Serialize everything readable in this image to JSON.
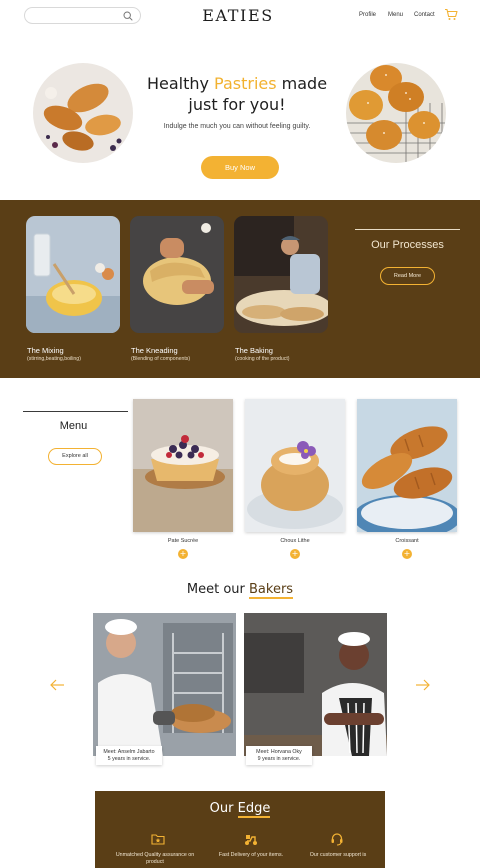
{
  "header": {
    "search_placeholder": "",
    "logo": "EATIES",
    "nav": [
      "Profile",
      "Menu",
      "Contact"
    ],
    "cart_icon": "cart-icon"
  },
  "hero": {
    "title_part1": "Healthy ",
    "title_accent": "Pastries",
    "title_part2": " made just for you!",
    "subtitle": "Indulge the much you can without feeling guilty.",
    "cta": "Buy Now",
    "accent_color": "#f3b233"
  },
  "processes": {
    "heading": "Our Processes",
    "read_more": "Read More",
    "band_color": "#5a3e16",
    "items": [
      {
        "title": "The Mixing",
        "sub": "(stirring,beating,boiling)"
      },
      {
        "title": "The Kneading",
        "sub": "(Blending of components)"
      },
      {
        "title": "The Baking",
        "sub": "(cooking of the product)"
      }
    ]
  },
  "menu": {
    "title": "Menu",
    "explore": "Explore all",
    "items": [
      {
        "name": "Pate Sucrée"
      },
      {
        "name": "Choux Lithe"
      },
      {
        "name": "Croissant"
      }
    ]
  },
  "bakers": {
    "title_part1": "Meet our ",
    "title_accent": "Bakers",
    "people": [
      {
        "line1": "Meet: Anselm Jabarto",
        "line2": "5 years in service."
      },
      {
        "line1": "Meet: Horvana Oky",
        "line2": "9 years in service."
      }
    ]
  },
  "edge": {
    "title_part1": "Our ",
    "title_accent": "Edge",
    "items": [
      {
        "icon": "folder-icon",
        "text": "Unmatched Quality assurance on product"
      },
      {
        "icon": "scooter-icon",
        "text": "Fast Delivery of your items."
      },
      {
        "icon": "headset-icon",
        "text": "Our customer support is"
      }
    ]
  }
}
